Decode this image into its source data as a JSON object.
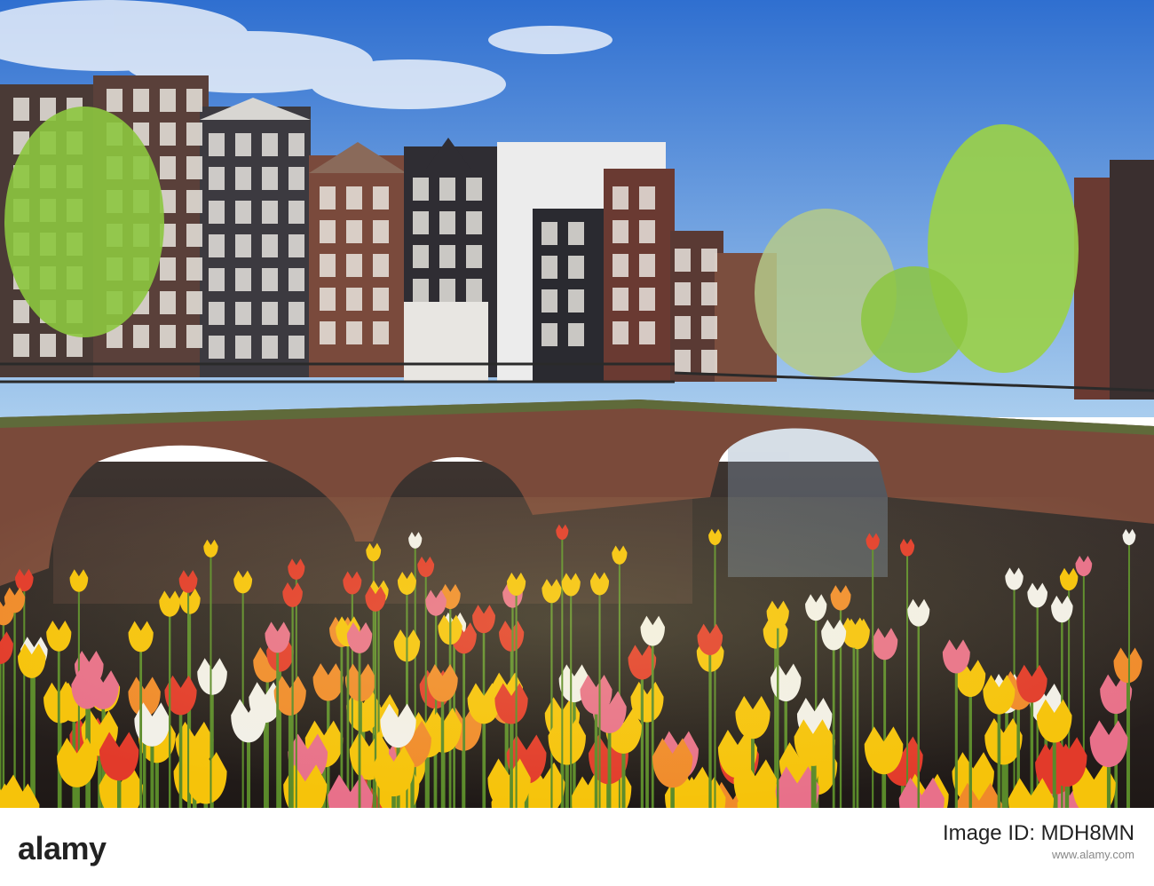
{
  "photo": {
    "subject": "canal-bridge-tulips",
    "colors": {
      "sky_top": "#2f6fd0",
      "sky_bottom": "#a9cdee",
      "water": "#3a302c",
      "bridge_brick": "#7a4a3a",
      "tulip_yellow": "#f6c30a",
      "tulip_red": "#e23a2a",
      "tulip_white": "#f2f0ea",
      "tree_green": "#8cc63f"
    }
  },
  "footer": {
    "logo": "alamy",
    "image_id_label": "Image ID: MDH8MN",
    "site": "www.alamy.com"
  }
}
